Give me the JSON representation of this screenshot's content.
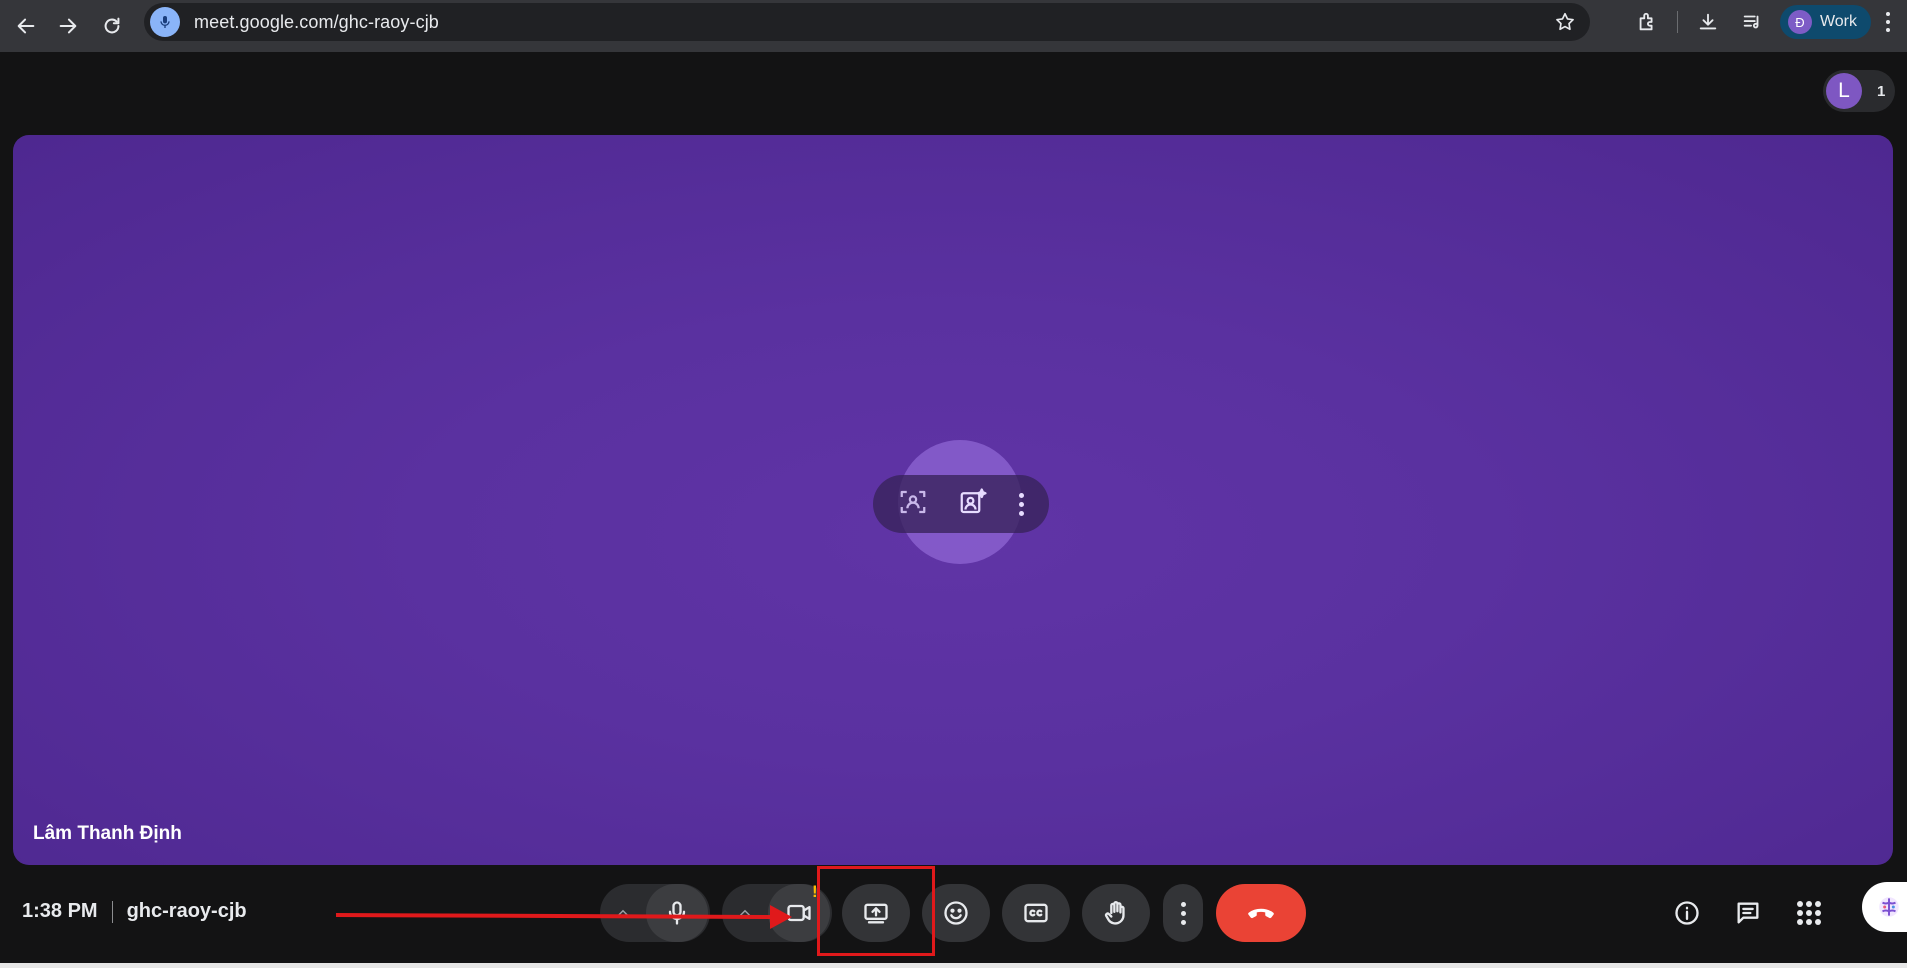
{
  "browser": {
    "url": "meet.google.com/ghc-raoy-cjb",
    "profile_initial": "Đ",
    "profile_name": "Work"
  },
  "meeting": {
    "participant_initial": "L",
    "participant_count": "1",
    "tile_name": "Lâm Thanh Định",
    "time": "1:38 PM",
    "code": "ghc-raoy-cjb",
    "camera_warning": "!"
  },
  "colors": {
    "tile_background": "#5a31a0",
    "end_call": "#ea4335",
    "annotation": "#e0191b",
    "warning": "#fbbc04"
  },
  "icons": {
    "browser": [
      "back-icon",
      "forward-icon",
      "reload-icon",
      "mic-icon",
      "star-icon",
      "extensions-icon",
      "download-icon",
      "media-queue-icon",
      "more-icon"
    ],
    "controls": [
      "more-options-icon",
      "mic-icon",
      "chevron-up-icon",
      "camera-icon",
      "present-screen-icon",
      "emoji-icon",
      "captions-icon",
      "raise-hand-icon",
      "more-vert-icon",
      "end-call-icon"
    ],
    "right": [
      "info-icon",
      "chat-icon",
      "apps-icon",
      "gemini-icon"
    ]
  }
}
